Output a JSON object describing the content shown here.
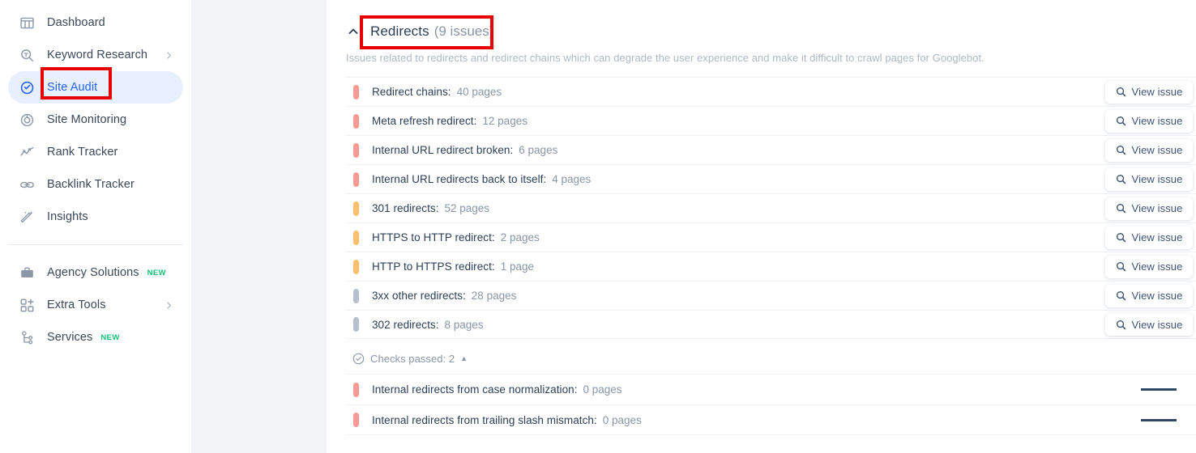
{
  "sidebar": {
    "items": [
      {
        "label": "Dashboard",
        "icon": "dashboard-icon",
        "active": false,
        "chevron": false,
        "badge": ""
      },
      {
        "label": "Keyword Research",
        "icon": "keyword-research-icon",
        "active": false,
        "chevron": true,
        "badge": ""
      },
      {
        "label": "Site Audit",
        "icon": "site-audit-icon",
        "active": true,
        "chevron": false,
        "badge": ""
      },
      {
        "label": "Site Monitoring",
        "icon": "site-monitoring-icon",
        "active": false,
        "chevron": false,
        "badge": ""
      },
      {
        "label": "Rank Tracker",
        "icon": "rank-tracker-icon",
        "active": false,
        "chevron": false,
        "badge": ""
      },
      {
        "label": "Backlink Tracker",
        "icon": "backlink-tracker-icon",
        "active": false,
        "chevron": false,
        "badge": ""
      },
      {
        "label": "Insights",
        "icon": "insights-icon",
        "active": false,
        "chevron": false,
        "badge": ""
      }
    ],
    "items_secondary": [
      {
        "label": "Agency Solutions",
        "icon": "briefcase-icon",
        "active": false,
        "chevron": false,
        "badge": "NEW"
      },
      {
        "label": "Extra Tools",
        "icon": "extra-tools-icon",
        "active": false,
        "chevron": true,
        "badge": ""
      },
      {
        "label": "Services",
        "icon": "services-icon",
        "active": false,
        "chevron": false,
        "badge": "NEW"
      }
    ]
  },
  "section": {
    "title": "Redirects",
    "count": "(9 issues)",
    "description": "Issues related to redirects and redirect chains which can degrade the user experience and make it difficult to crawl pages for Googlebot.",
    "collapsed": false
  },
  "issues": [
    {
      "name": "Redirect chains:",
      "count": "40 pages",
      "severity": "high",
      "button": "View issue",
      "spark_height": 20,
      "spark_line_shade": "dark"
    },
    {
      "name": "Meta refresh redirect:",
      "count": "12 pages",
      "severity": "high",
      "button": "View issue",
      "spark_height": 16,
      "spark_line_shade": "mid"
    },
    {
      "name": "Internal URL redirect broken:",
      "count": "6 pages",
      "severity": "high",
      "button": "View issue",
      "spark_height": 12,
      "spark_line_shade": "dark"
    },
    {
      "name": "Internal URL redirects back to itself:",
      "count": "4 pages",
      "severity": "high",
      "button": "View issue",
      "spark_height": 5,
      "spark_line_shade": "dark"
    },
    {
      "name": "301 redirects:",
      "count": "52 pages",
      "severity": "med",
      "button": "View issue",
      "spark_height": 19,
      "spark_line_shade": "mid"
    },
    {
      "name": "HTTPS to HTTP redirect:",
      "count": "2 pages",
      "severity": "med",
      "button": "View issue",
      "spark_height": 13,
      "spark_line_shade": "mid"
    },
    {
      "name": "HTTP to HTTPS redirect:",
      "count": "1 page",
      "severity": "med",
      "button": "View issue",
      "spark_height": 4,
      "spark_line_shade": "mid"
    },
    {
      "name": "3xx other redirects:",
      "count": "28 pages",
      "severity": "low",
      "button": "View issue",
      "spark_height": 18,
      "spark_line_shade": "mid"
    },
    {
      "name": "302 redirects:",
      "count": "8 pages",
      "severity": "low",
      "button": "View issue",
      "spark_height": 20,
      "spark_line_shade": "dark"
    }
  ],
  "checks_passed": {
    "label": "Checks passed: 2",
    "expanded": true
  },
  "passed_issues": [
    {
      "name": "Internal redirects from case normalization:",
      "count": "0 pages",
      "severity": "high"
    },
    {
      "name": "Internal redirects from trailing slash mismatch:",
      "count": "0 pages",
      "severity": "high"
    }
  ],
  "colors": {
    "accent": "#2563f0",
    "severity_high": "#f79a96",
    "severity_med": "#fbbf6e",
    "severity_low": "#b6bfcc",
    "annotation": "#e60000",
    "spark_line": "#2f4763",
    "spark_fill": "#e9ecf1",
    "gutter": "#f2f3f6"
  }
}
